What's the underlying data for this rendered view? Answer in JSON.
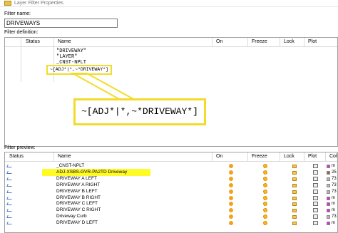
{
  "window": {
    "title": "Layer Filter Properties"
  },
  "filter_name": {
    "label": "Filter name:",
    "value": "DRIVEWAYS"
  },
  "filter_definition": {
    "label": "Filter definition:",
    "columns": [
      "Status",
      "Name",
      "On",
      "Freeze",
      "Lock",
      "Plot"
    ],
    "rows": [
      "\"DRIVEWAY\"",
      "\"LAYER\"",
      "_CNST-NPLT",
      "~[ADJ*|*,~*DRIVEWAY*]"
    ]
  },
  "callout": {
    "text": "~[ADJ*|*,~*DRIVEWAY*]"
  },
  "filter_preview": {
    "label": "Filter preview:",
    "columns": [
      "Status",
      "Name",
      "On",
      "Freeze",
      "Lock",
      "Plot",
      "Colo"
    ],
    "rows": [
      {
        "name": "_CNST-NPLT",
        "color_value": "m",
        "color": "#d92fd9",
        "highlight": false
      },
      {
        "name": "ADJ-XSBS-GVR-PA2TD Driveway",
        "color_value": "25",
        "color": "#8a6f4f",
        "highlight": true
      },
      {
        "name": "DRIVEWAY A LEFT",
        "color_value": "73",
        "color": "#b6b6b6",
        "highlight": false
      },
      {
        "name": "DRIVEWAY A RIGHT",
        "color_value": "73",
        "color": "#b6b6b6",
        "highlight": false
      },
      {
        "name": "DRIVEWAY B LEFT",
        "color_value": "73",
        "color": "#b6b6b6",
        "highlight": false
      },
      {
        "name": "DRIVEWAY B RIGHT",
        "color_value": "m",
        "color": "#d92fd9",
        "highlight": false
      },
      {
        "name": "DRIVEWAY C LEFT",
        "color_value": "m",
        "color": "#d92fd9",
        "highlight": false
      },
      {
        "name": "DRIVEWAY C RIGHT",
        "color_value": "m",
        "color": "#d92fd9",
        "highlight": false
      },
      {
        "name": "Driveway Curb",
        "color_value": "73",
        "color": "#b6b6b6",
        "highlight": false
      },
      {
        "name": "DRIVEWAY D LEFT",
        "color_value": "m",
        "color": "#d92fd9",
        "highlight": false
      }
    ]
  },
  "colors": {
    "highlight": "#fffb27",
    "callout_border": "#f2dc2a"
  }
}
